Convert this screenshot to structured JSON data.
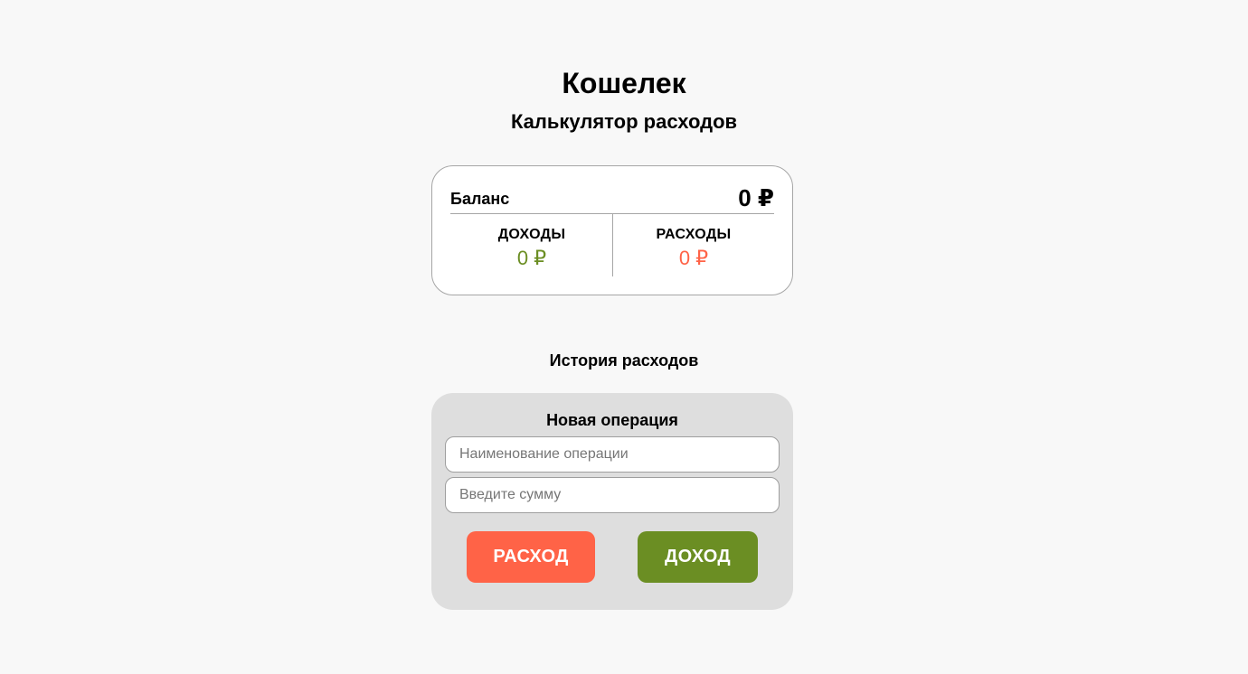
{
  "header": {
    "title": "Кошелек",
    "subtitle": "Калькулятор расходов"
  },
  "balance_card": {
    "balance_label": "Баланс",
    "balance_value": "0 ₽",
    "income": {
      "label": "ДОХОДЫ",
      "value": "0 ₽"
    },
    "expense": {
      "label": "РАСХОДЫ",
      "value": "0 ₽"
    }
  },
  "history": {
    "title": "История расходов"
  },
  "new_operation": {
    "title": "Новая операция",
    "name_input": {
      "value": "",
      "placeholder": "Наименование операции"
    },
    "amount_input": {
      "value": "",
      "placeholder": "Введите сумму"
    },
    "expense_button_label": "РАСХОД",
    "income_button_label": "ДОХОД"
  },
  "colors": {
    "page_background": "#f8f8f8",
    "card_background": "#ffffff",
    "operation_card_background": "#dedede",
    "income_accent": "#6b8e23",
    "expense_accent": "#ff6347",
    "border": "#a6a6a6"
  }
}
